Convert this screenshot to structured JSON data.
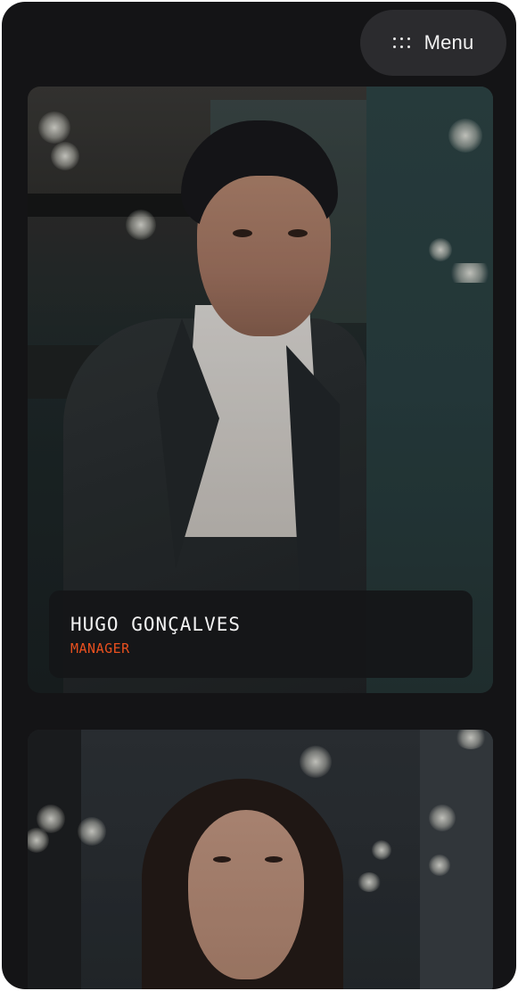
{
  "header": {
    "menu_icon": "dots-grid-icon",
    "menu_label": "Menu"
  },
  "team": [
    {
      "name": "HUGO GONÇALVES",
      "role": "MANAGER"
    },
    {
      "name": "",
      "role": ""
    }
  ],
  "colors": {
    "background": "#141416",
    "menu_pill": "#2b2b2e",
    "role_accent": "#e8501f",
    "caption_bg": "#141618"
  }
}
